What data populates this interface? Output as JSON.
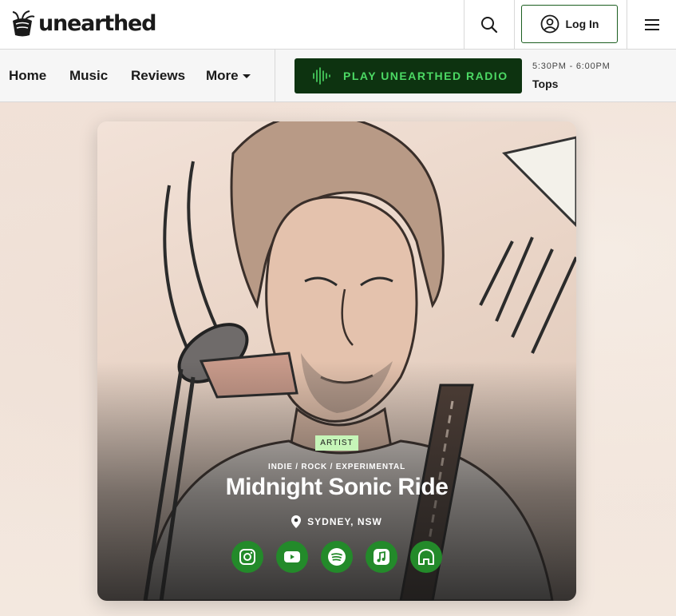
{
  "brand": {
    "name": "unearthed"
  },
  "header": {
    "search_icon": "search-icon",
    "login_label": "Log In",
    "menu_icon": "hamburger-menu-icon"
  },
  "nav": {
    "items": [
      {
        "label": "Home"
      },
      {
        "label": "Music"
      },
      {
        "label": "Reviews"
      },
      {
        "label": "More"
      }
    ]
  },
  "radio": {
    "button_label": "PLAY UNEARTHED RADIO",
    "now_time": "5:30PM - 6:00PM",
    "now_show": "Tops"
  },
  "artist": {
    "badge": "ARTIST",
    "genres": "INDIE / ROCK / EXPERIMENTAL",
    "name": "Midnight Sonic Ride",
    "location": "SYDNEY, NSW",
    "socials": [
      {
        "icon": "instagram-icon"
      },
      {
        "icon": "youtube-icon"
      },
      {
        "icon": "spotify-icon"
      },
      {
        "icon": "apple-music-icon"
      },
      {
        "icon": "home-icon"
      }
    ]
  },
  "colors": {
    "accent_green": "#238a2a",
    "radio_bg": "#0d3310",
    "radio_text": "#4cd964",
    "badge_bg": "#c6f5b8"
  }
}
